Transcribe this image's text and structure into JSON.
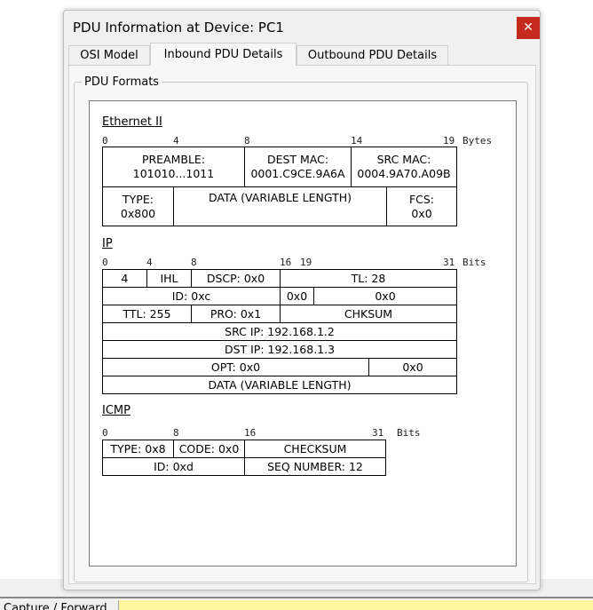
{
  "window": {
    "title": "PDU Information at Device: PC1",
    "close_label": "✕"
  },
  "tabs": [
    {
      "label": "OSI Model"
    },
    {
      "label": "Inbound PDU Details"
    },
    {
      "label": "Outbound PDU Details"
    }
  ],
  "group_label": "PDU Formats",
  "ethernet": {
    "title": "Ethernet II",
    "scale": {
      "b0": "0",
      "b4": "4",
      "b8": "8",
      "b14": "14",
      "b19": "19",
      "unit": "Bytes"
    },
    "preamble": {
      "label": "PREAMBLE:",
      "value": "101010...1011"
    },
    "dest_mac": {
      "label": "DEST MAC:",
      "value": "0001.C9CE.9A6A"
    },
    "src_mac": {
      "label": "SRC MAC:",
      "value": "0004.9A70.A09B"
    },
    "type": {
      "label": "TYPE:",
      "value": "0x800"
    },
    "data": "DATA (VARIABLE LENGTH)",
    "fcs": {
      "label": "FCS:",
      "value": "0x0"
    }
  },
  "ip": {
    "title": "IP",
    "scale": {
      "b0": "0",
      "b4": "4",
      "b8": "8",
      "b16": "16",
      "b19": "19",
      "b31": "31",
      "unit": "Bits"
    },
    "version": "4",
    "ihl": "IHL",
    "dscp": "DSCP: 0x0",
    "tl": "TL: 28",
    "id": "ID: 0xc",
    "flags": "0x0",
    "frag": "0x0",
    "ttl": "TTL: 255",
    "pro": "PRO: 0x1",
    "chksum": "CHKSUM",
    "src_ip": "SRC IP: 192.168.1.2",
    "dst_ip": "DST IP: 192.168.1.3",
    "opt": "OPT: 0x0",
    "padding": "0x0",
    "data": "DATA (VARIABLE LENGTH)"
  },
  "icmp": {
    "title": "ICMP",
    "scale": {
      "b0": "0",
      "b8": "8",
      "b16": "16",
      "b31": "31",
      "unit": "Bits"
    },
    "type": "TYPE: 0x8",
    "code": "CODE: 0x0",
    "checksum": "CHECKSUM",
    "id": "ID: 0xd",
    "seq": "SEQ NUMBER: 12"
  },
  "bottom_bar": {
    "tab_label": "Capture / Forward"
  }
}
